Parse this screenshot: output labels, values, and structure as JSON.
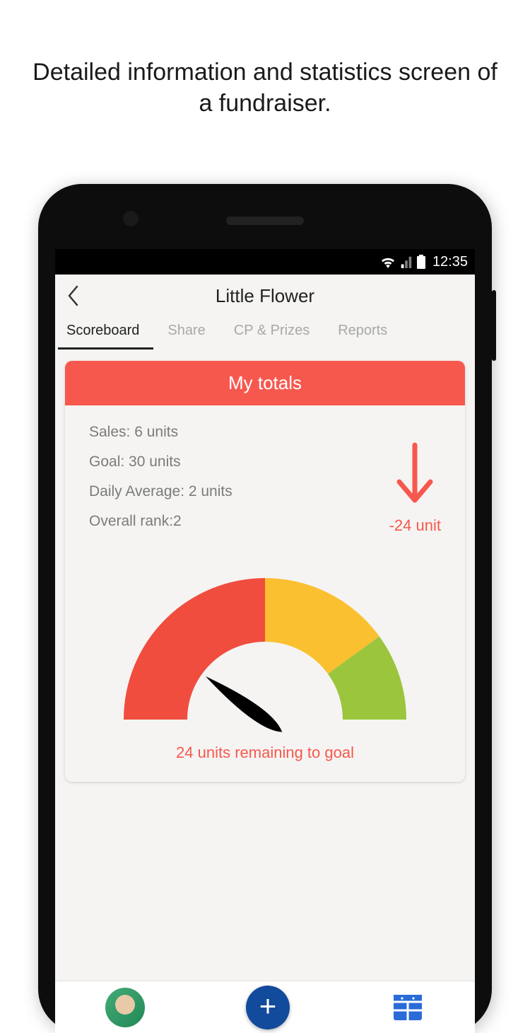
{
  "promo": "Detailed information and statistics screen of a fundraiser.",
  "statusbar": {
    "time": "12:35"
  },
  "header": {
    "title": "Little Flower"
  },
  "tabs": [
    {
      "label": "Scoreboard",
      "active": true
    },
    {
      "label": "Share",
      "active": false
    },
    {
      "label": "CP & Prizes",
      "active": false
    },
    {
      "label": "Reports",
      "active": false
    }
  ],
  "card": {
    "title": "My totals",
    "stats": {
      "sales": {
        "label": "Sales",
        "value": 6,
        "unit": "units",
        "text": "Sales: 6 units"
      },
      "goal": {
        "label": "Goal",
        "value": 30,
        "unit": "units",
        "text": "Goal: 30 units"
      },
      "daily": {
        "label": "Daily Average",
        "value": 2,
        "unit": "units",
        "text": "Daily Average: 2 units"
      },
      "rank": {
        "label": "Overall rank",
        "value": 2,
        "text": "Overall rank:2"
      }
    },
    "delta": {
      "value": -24,
      "unit": "unit",
      "text": "-24 unit",
      "direction": "down"
    },
    "remaining": {
      "value": 24,
      "text": "24 units remaining to goal"
    }
  },
  "colors": {
    "accent_red": "#f7584e",
    "gauge_red": "#f04d3f",
    "gauge_yellow": "#fac030",
    "gauge_green": "#9bc53d",
    "fab_blue": "#124a9c",
    "icon_blue": "#2a6bd8"
  },
  "chart_data": {
    "type": "gauge",
    "title": "Progress to goal",
    "value": 6,
    "min": 0,
    "max": 30,
    "fraction": 0.2,
    "segments": [
      {
        "name": "low",
        "color": "#f04d3f",
        "range": [
          0.0,
          0.5
        ]
      },
      {
        "name": "mid",
        "color": "#fac030",
        "range": [
          0.5,
          0.8
        ]
      },
      {
        "name": "high",
        "color": "#9bc53d",
        "range": [
          0.8,
          1.0
        ]
      }
    ],
    "needle_fraction": 0.2,
    "remaining": 24
  }
}
